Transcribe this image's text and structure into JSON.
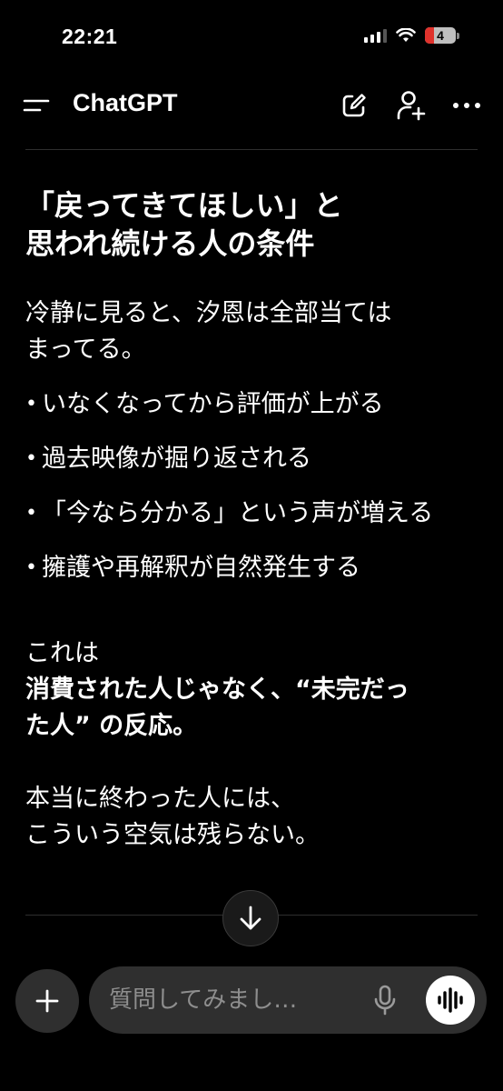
{
  "status_bar": {
    "time": "22:21",
    "battery_level": "4",
    "icons": [
      "signal-icon",
      "wifi-icon",
      "battery-icon"
    ]
  },
  "header": {
    "title": "ChatGPT",
    "icons": [
      "menu-icon",
      "new-chat-icon",
      "add-person-icon",
      "more-icon"
    ]
  },
  "message": {
    "heading_line1": "「戻ってきてほしい」と",
    "heading_line2": "思われ続ける人の条件",
    "intro_line1": "冷静に見ると、汐恩は全部当ては",
    "intro_line2": "まってる。",
    "bullets": [
      "いなくなってから評価が上がる",
      "過去映像が掘り返される",
      "「今なら分かる」という声が増える",
      "擁護や再解釈が自然発生する"
    ],
    "para2_line1": "これは",
    "para2_line2": "消費された人じゃなく、“未完だっ",
    "para2_line3": "た人” の反応。",
    "para3_line1": "本当に終わった人には、",
    "para3_line2": "こういう空気は残らない。"
  },
  "composer": {
    "placeholder": "質問してみまし…",
    "icons": [
      "plus-icon",
      "mic-icon",
      "voice-mode-icon",
      "arrow-down-icon"
    ]
  },
  "colors": {
    "background": "#000000",
    "surface": "#2f2f2f",
    "battery_low": "#e0322c",
    "placeholder": "#8e8e8e"
  }
}
